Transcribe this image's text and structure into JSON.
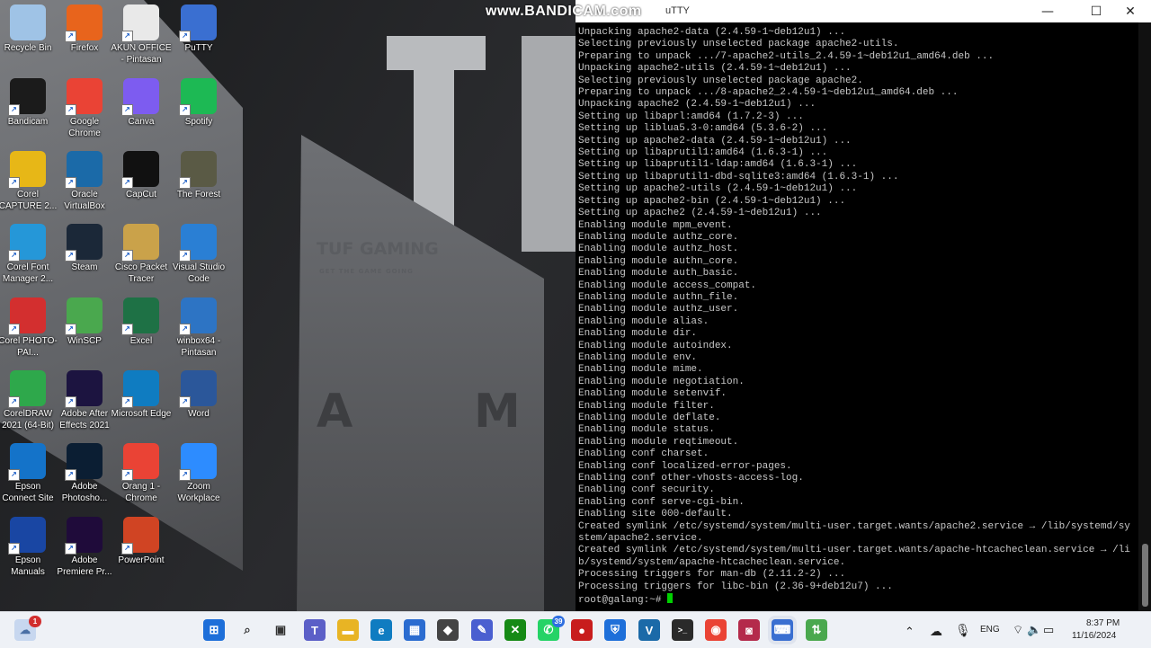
{
  "watermark": "www.BANDICAM.com",
  "wallpaper": {
    "brand": "TUF GAMING",
    "tagline": "GET THE GAME GOING",
    "letter_a": "A",
    "letter_m": "M"
  },
  "desktop_icons": [
    {
      "label": "Recycle Bin",
      "icon": "recycle-bin-icon",
      "color": "#9fc3e6"
    },
    {
      "label": "Firefox",
      "icon": "firefox-icon",
      "color": "#e8641c"
    },
    {
      "label": "AKUN OFFICE - Pintasan",
      "icon": "document-icon",
      "color": "#e9e9e9"
    },
    {
      "label": "PuTTY",
      "icon": "putty-icon",
      "color": "#3a6fd1"
    },
    {
      "label": "Bandicam",
      "icon": "bandicam-icon",
      "color": "#1b1b1b"
    },
    {
      "label": "Google Chrome",
      "icon": "chrome-icon",
      "color": "#ea4335"
    },
    {
      "label": "Canva",
      "icon": "canva-icon",
      "color": "#7d5cf0"
    },
    {
      "label": "Spotify",
      "icon": "spotify-icon",
      "color": "#1db954"
    },
    {
      "label": "Corel CAPTURE 2...",
      "icon": "corel-capture-icon",
      "color": "#e7b717"
    },
    {
      "label": "Oracle VirtualBox",
      "icon": "virtualbox-icon",
      "color": "#1b6aa8"
    },
    {
      "label": "CapCut",
      "icon": "capcut-icon",
      "color": "#111111"
    },
    {
      "label": "The Forest",
      "icon": "the-forest-icon",
      "color": "#5a5a45"
    },
    {
      "label": "Corel Font Manager 2...",
      "icon": "corel-font-icon",
      "color": "#2597d8"
    },
    {
      "label": "Steam",
      "icon": "steam-icon",
      "color": "#1b2838"
    },
    {
      "label": "Cisco Packet Tracer",
      "icon": "packet-tracer-icon",
      "color": "#caa24a"
    },
    {
      "label": "Visual Studio Code",
      "icon": "vscode-icon",
      "color": "#2a7fd4"
    },
    {
      "label": "Corel PHOTO-PAI...",
      "icon": "corel-photo-icon",
      "color": "#d32f2f"
    },
    {
      "label": "WinSCP",
      "icon": "winscp-icon",
      "color": "#4aa84e"
    },
    {
      "label": "Excel",
      "icon": "excel-icon",
      "color": "#1e7145"
    },
    {
      "label": "winbox64 - Pintasan",
      "icon": "winbox-icon",
      "color": "#2d74c4"
    },
    {
      "label": "CorelDRAW 2021 (64-Bit)",
      "icon": "coreldraw-icon",
      "color": "#2ea84b"
    },
    {
      "label": "Adobe After Effects 2021",
      "icon": "after-effects-icon",
      "color": "#1c1440"
    },
    {
      "label": "Microsoft Edge",
      "icon": "edge-icon",
      "color": "#0f7cc1"
    },
    {
      "label": "Word",
      "icon": "word-icon",
      "color": "#2b579a"
    },
    {
      "label": "Epson Connect Site",
      "icon": "epson-connect-icon",
      "color": "#1473c9"
    },
    {
      "label": "Adobe Photosho...",
      "icon": "photoshop-icon",
      "color": "#0b1e33"
    },
    {
      "label": "Orang 1 - Chrome",
      "icon": "chrome-profile-icon",
      "color": "#ea4335"
    },
    {
      "label": "Zoom Workplace",
      "icon": "zoom-icon",
      "color": "#2d8cff"
    },
    {
      "label": "Epson Manuals",
      "icon": "epson-manuals-icon",
      "color": "#1946a3"
    },
    {
      "label": "Adobe Premiere Pr...",
      "icon": "premiere-icon",
      "color": "#1f0b3a"
    },
    {
      "label": "PowerPoint",
      "icon": "powerpoint-icon",
      "color": "#d04423"
    }
  ],
  "putty": {
    "title": "uTTY",
    "minimize": "—",
    "maximize": "☐",
    "close": "✕",
    "lines": [
      "Unpacking apache2-data (2.4.59-1~deb12u1) ...",
      "Selecting previously unselected package apache2-utils.",
      "Preparing to unpack .../7-apache2-utils_2.4.59-1~deb12u1_amd64.deb ...",
      "Unpacking apache2-utils (2.4.59-1~deb12u1) ...",
      "Selecting previously unselected package apache2.",
      "Preparing to unpack .../8-apache2_2.4.59-1~deb12u1_amd64.deb ...",
      "Unpacking apache2 (2.4.59-1~deb12u1) ...",
      "Setting up libaprl:amd64 (1.7.2-3) ...",
      "Setting up liblua5.3-0:amd64 (5.3.6-2) ...",
      "Setting up apache2-data (2.4.59-1~deb12u1) ...",
      "Setting up libaprutil1:amd64 (1.6.3-1) ...",
      "Setting up libaprutil1-ldap:amd64 (1.6.3-1) ...",
      "Setting up libaprutil1-dbd-sqlite3:amd64 (1.6.3-1) ...",
      "Setting up apache2-utils (2.4.59-1~deb12u1) ...",
      "Setting up apache2-bin (2.4.59-1~deb12u1) ...",
      "Setting up apache2 (2.4.59-1~deb12u1) ...",
      "Enabling module mpm_event.",
      "Enabling module authz_core.",
      "Enabling module authz_host.",
      "Enabling module authn_core.",
      "Enabling module auth_basic.",
      "Enabling module access_compat.",
      "Enabling module authn_file.",
      "Enabling module authz_user.",
      "Enabling module alias.",
      "Enabling module dir.",
      "Enabling module autoindex.",
      "Enabling module env.",
      "Enabling module mime.",
      "Enabling module negotiation.",
      "Enabling module setenvif.",
      "Enabling module filter.",
      "Enabling module deflate.",
      "Enabling module status.",
      "Enabling module reqtimeout.",
      "Enabling conf charset.",
      "Enabling conf localized-error-pages.",
      "Enabling conf other-vhosts-access-log.",
      "Enabling conf security.",
      "Enabling conf serve-cgi-bin.",
      "Enabling site 000-default.",
      "Created symlink /etc/systemd/system/multi-user.target.wants/apache2.service → /lib/systemd/sy",
      "stem/apache2.service.",
      "Created symlink /etc/systemd/system/multi-user.target.wants/apache-htcacheclean.service → /li",
      "b/systemd/system/apache-htcacheclean.service.",
      "Processing triggers for man-db (2.11.2-2) ...",
      "Processing triggers for libc-bin (2.36-9+deb12u7) ..."
    ],
    "prompt": "root@galang:~# "
  },
  "taskbar": {
    "notification_badge": "1",
    "whatsapp_badge": "39",
    "icons": [
      {
        "name": "start-icon",
        "glyph": "⊞",
        "color": "#1e6fd9"
      },
      {
        "name": "search-icon",
        "glyph": "⌕",
        "color": "#333333"
      },
      {
        "name": "task-view-icon",
        "glyph": "▣",
        "color": "#333333"
      },
      {
        "name": "teams-icon",
        "glyph": "T",
        "color": "#5b5fc7"
      },
      {
        "name": "file-explorer-icon",
        "glyph": "▬",
        "color": "#e8b424"
      },
      {
        "name": "edge-icon",
        "glyph": "e",
        "color": "#0f7cc1"
      },
      {
        "name": "store-icon",
        "glyph": "▦",
        "color": "#2b6cd0"
      },
      {
        "name": "cube-icon",
        "glyph": "◆",
        "color": "#444444"
      },
      {
        "name": "editor-icon",
        "glyph": "✎",
        "color": "#4a5fd0"
      },
      {
        "name": "xbox-icon",
        "glyph": "✕",
        "color": "#168a16"
      },
      {
        "name": "whatsapp-icon",
        "glyph": "✆",
        "color": "#25d366"
      },
      {
        "name": "bandicam-icon",
        "glyph": "●",
        "color": "#c81d1d"
      },
      {
        "name": "security-icon",
        "glyph": "⛨",
        "color": "#1e6fd9"
      },
      {
        "name": "virtualbox-icon",
        "glyph": "V",
        "color": "#1b6aa8"
      },
      {
        "name": "terminal-icon",
        "glyph": ">_",
        "color": "#2a2a2a"
      },
      {
        "name": "chrome-icon",
        "glyph": "◉",
        "color": "#ea4335"
      },
      {
        "name": "capture-icon",
        "glyph": "◙",
        "color": "#b42a4b"
      },
      {
        "name": "putty-icon",
        "glyph": "⌨",
        "color": "#3a6fd1"
      },
      {
        "name": "winscp-icon",
        "glyph": "⇅",
        "color": "#4aa84e"
      }
    ],
    "language": "ENG",
    "time": "8:37 PM",
    "date": "11/16/2024"
  }
}
